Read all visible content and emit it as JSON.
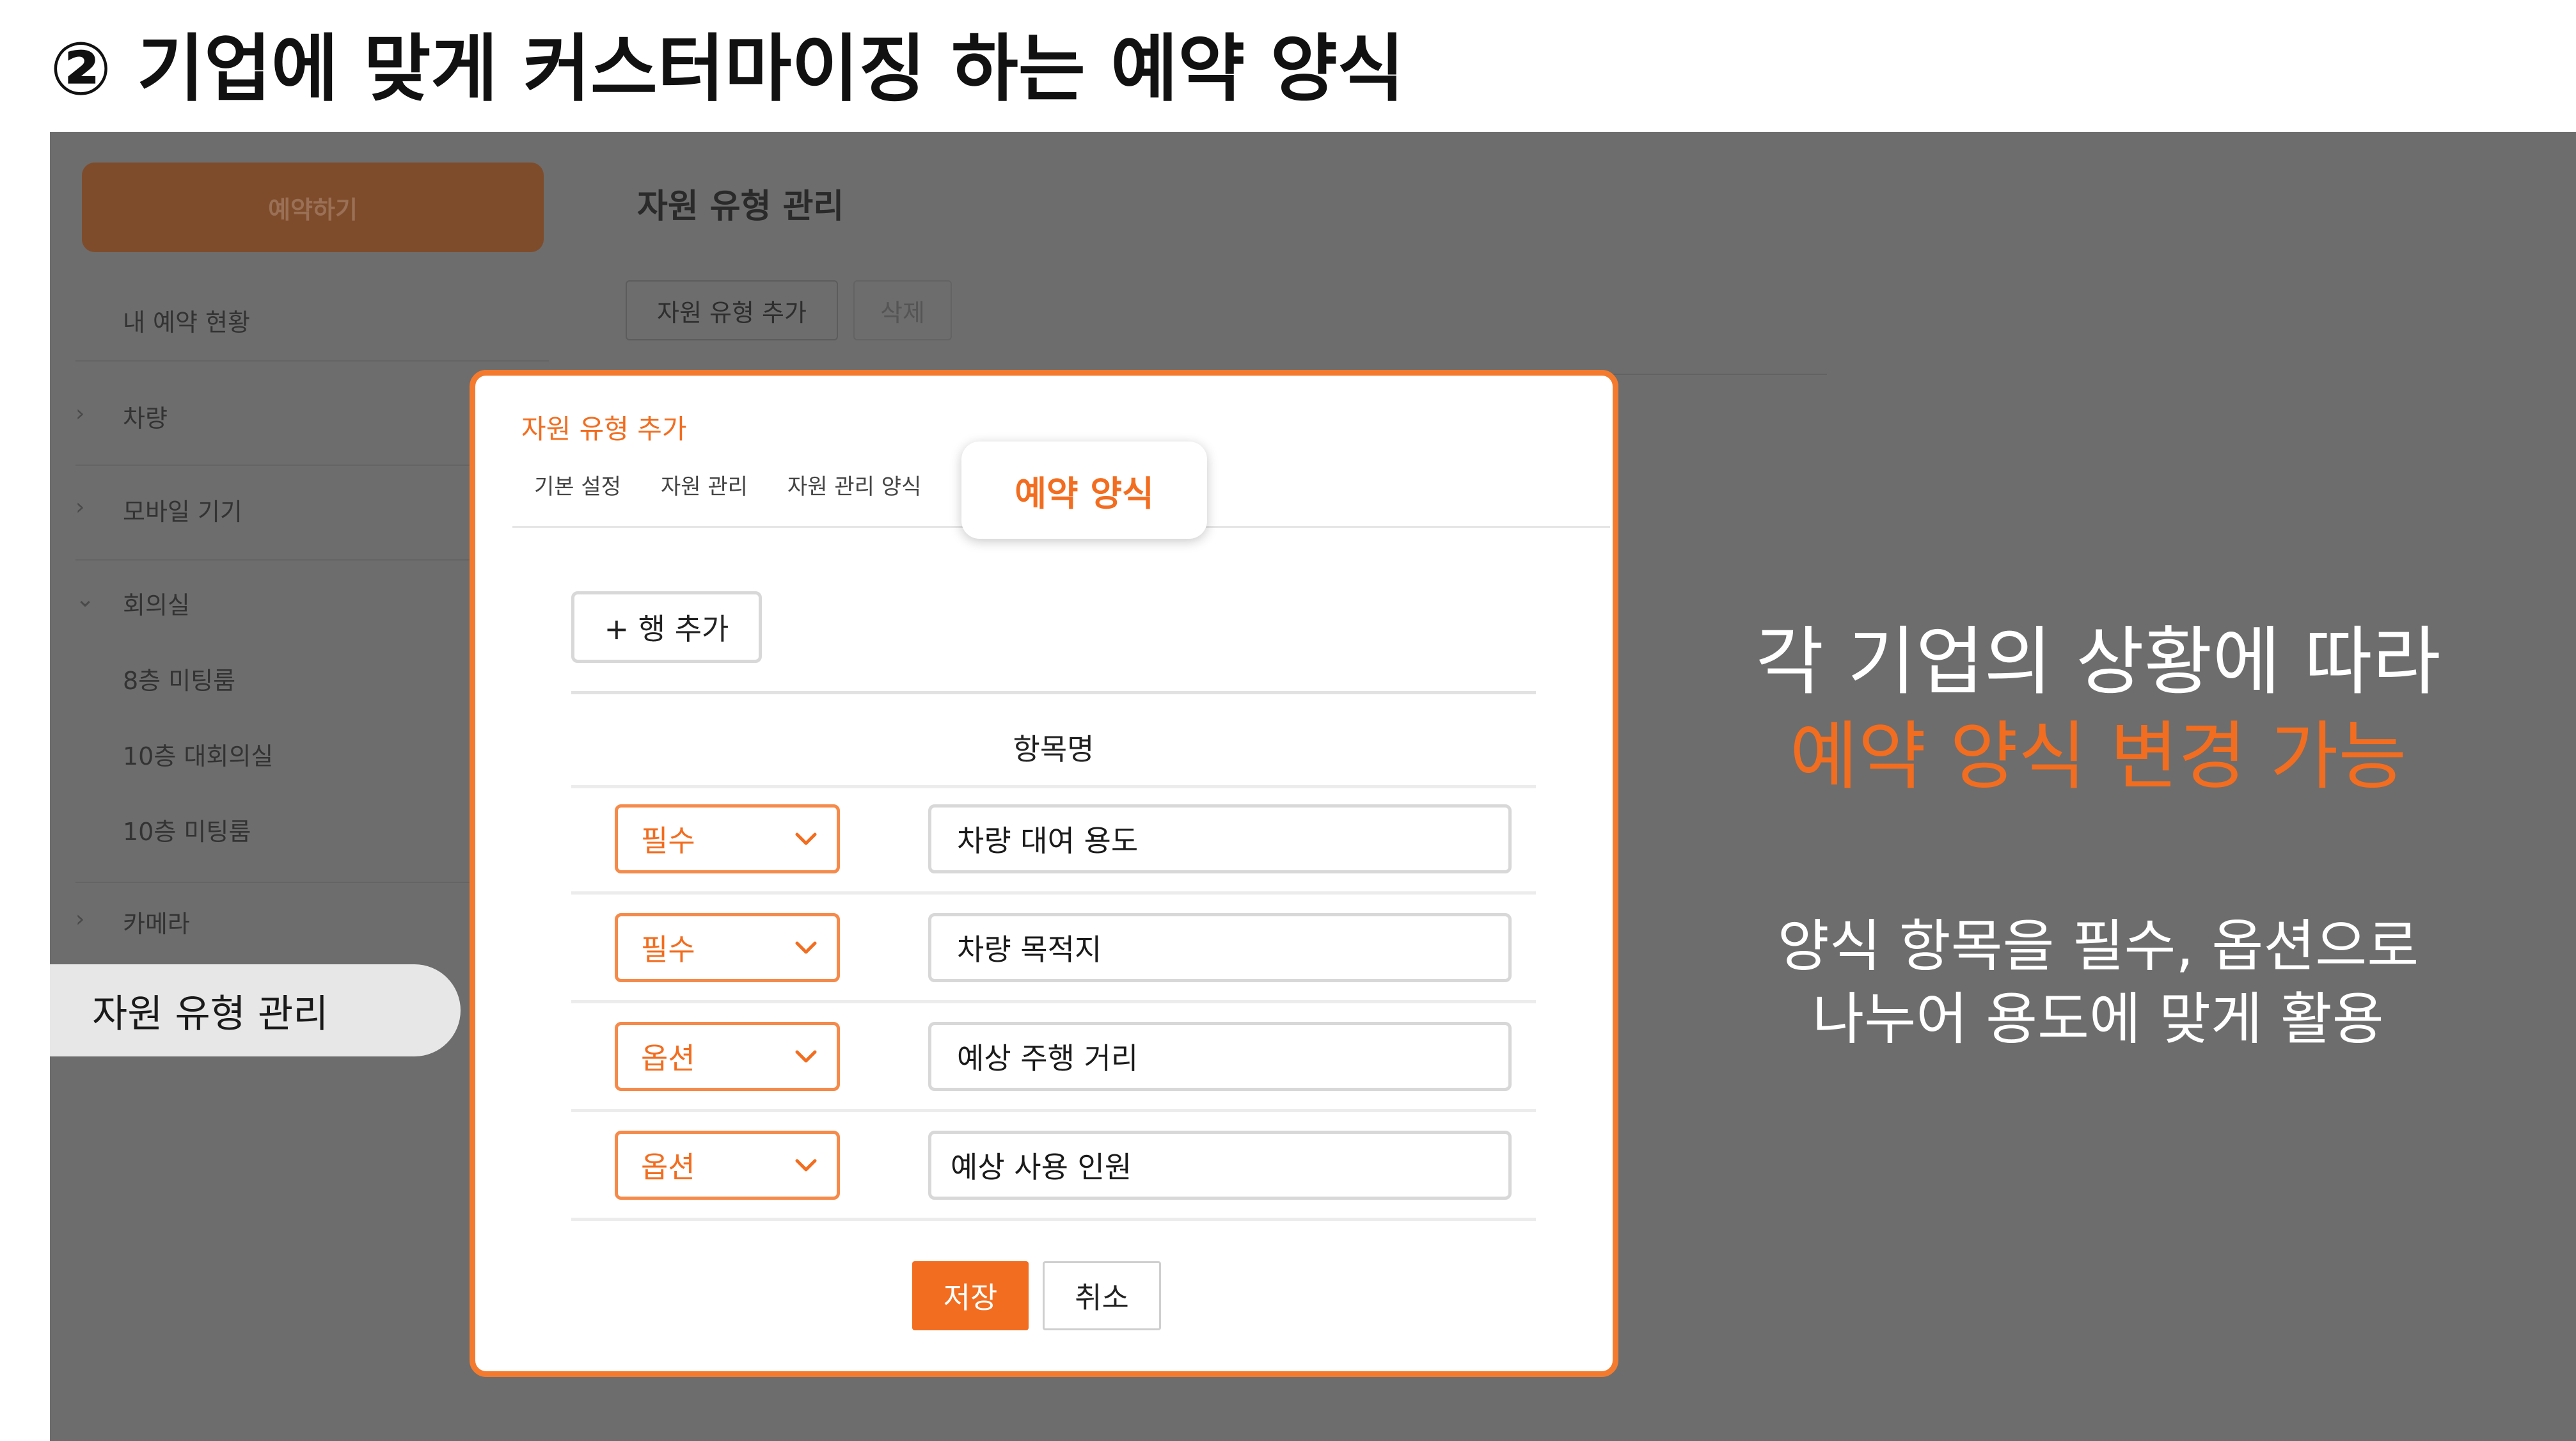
{
  "slide": {
    "title": "② 기업에 맞게 커스터마이징 하는 예약 양식"
  },
  "sidebar": {
    "reserve_button": "예약하기",
    "my_reservations": "내 예약 현황",
    "items": [
      {
        "label": "차량",
        "chevron": "chevron-right-icon"
      },
      {
        "label": "모바일 기기",
        "chevron": "chevron-right-icon"
      },
      {
        "label": "회의실",
        "chevron": "chevron-down-icon"
      },
      {
        "label": "8층 미팅룸"
      },
      {
        "label": "10층 대회의실"
      },
      {
        "label": "10층 미팅룸"
      },
      {
        "label": "카메라",
        "chevron": "chevron-right-icon"
      }
    ],
    "active_item": "자원 유형 관리"
  },
  "background_page": {
    "title": "자원 유형 관리",
    "add_button": "자원 유형 추가",
    "delete_button": "삭제"
  },
  "modal": {
    "title": "자원 유형 추가",
    "tabs": [
      "기본 설정",
      "자원 관리",
      "자원 관리 양식",
      "예약 양식"
    ],
    "active_tab": "예약 양식",
    "add_row_button": "+ 행 추가",
    "column_header": "항목명",
    "rows": [
      {
        "type": "필수",
        "name": "차량 대여 용도"
      },
      {
        "type": "필수",
        "name": "차량 목적지"
      },
      {
        "type": "옵션",
        "name": "예상 주행 거리"
      },
      {
        "type": "옵션",
        "name": "예상 사용 인원"
      }
    ],
    "save_button": "저장",
    "cancel_button": "취소"
  },
  "annotation": {
    "line1": "각 기업의 상황에 따라",
    "line2": "예약 양식 변경 가능",
    "line3": "양식 항목을 필수, 옵션으로",
    "line4": "나누어 용도에 맞게 활용"
  },
  "colors": {
    "accent": "#f26d1f",
    "overlay": "#6d6d6d",
    "modal_border": "#f47a2e"
  }
}
